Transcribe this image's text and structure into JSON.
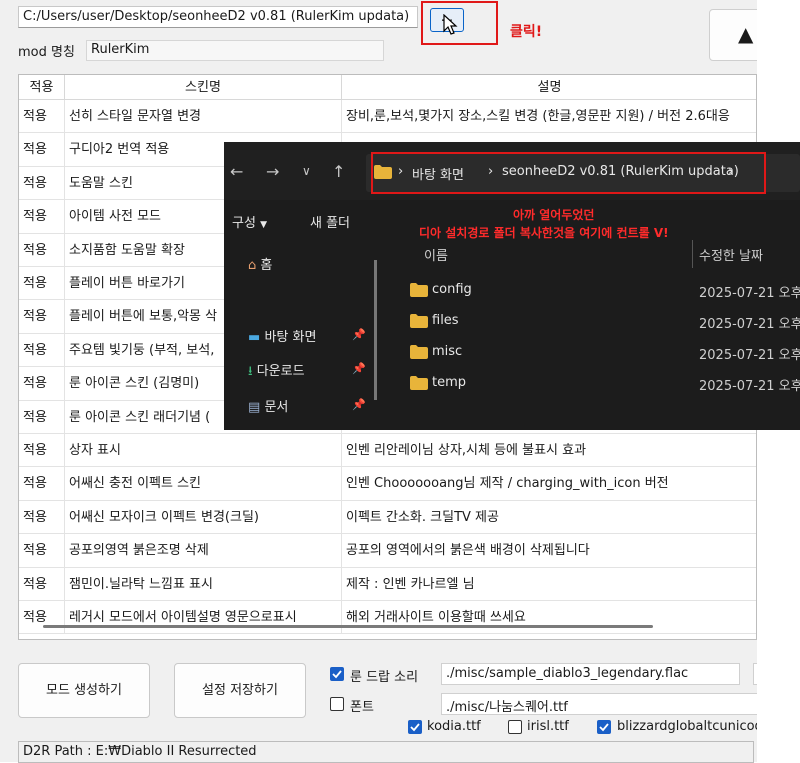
{
  "app": {
    "path_value": "C:/Users/user/Desktop/seonheeD2 v0.81 (RulerKim updata)",
    "browse_label": "...",
    "click_note": "클릭!",
    "up_label": "▲",
    "mod_name_label": "mod 명칭",
    "mod_name_value": "RulerKim",
    "columns": [
      "적용",
      "스킨명",
      "설명"
    ],
    "rows": [
      {
        "apply": "적용",
        "name": "선히 스타일 문자열 변경",
        "desc": "장비,룬,보석,몇가지 장소,스킬 변경 (한글,영문판 지원) / 버전 2.6대응"
      },
      {
        "apply": "적용",
        "name": "구디아2 번역 적용",
        "desc": ""
      },
      {
        "apply": "적용",
        "name": "도움말 스킨",
        "desc": ""
      },
      {
        "apply": "적용",
        "name": "아이템 사전 모드",
        "desc": ""
      },
      {
        "apply": "적용",
        "name": "소지품함 도움말 확장",
        "desc": ""
      },
      {
        "apply": "적용",
        "name": "플레이 버튼 바로가기",
        "desc": ""
      },
      {
        "apply": "적용",
        "name": "플레이 버튼에 보통,악몽 삭",
        "desc": ""
      },
      {
        "apply": "적용",
        "name": "주요템 빛기둥 (부적, 보석,",
        "desc": ""
      },
      {
        "apply": "적용",
        "name": "룬 아이콘 스킨 (김명미)",
        "desc": ""
      },
      {
        "apply": "적용",
        "name": "룬 아이콘 스킨 래더기념 (",
        "desc": ""
      },
      {
        "apply": "적용",
        "name": "상자 표시",
        "desc": "인벤 리안레이님 상자,시체 등에 불표시 효과"
      },
      {
        "apply": "적용",
        "name": "어쌔신 충전 이펙트 스킨",
        "desc": "인벤 Chooooooang님 제작 / charging_with_icon 버전"
      },
      {
        "apply": "적용",
        "name": "어쌔신 모자이크 이펙트 변경(크딜)",
        "desc": "이펙트 간소화. 크딜TV 제공"
      },
      {
        "apply": "적용",
        "name": "공포의영역 붉은조명 삭제",
        "desc": "공포의 영역에서의 붉은색 배경이 삭제됩니다"
      },
      {
        "apply": "적용",
        "name": "잼민이.닐라탁 느낌표 표시",
        "desc": "제작 : 인벤 카나르엘 님"
      },
      {
        "apply": "적용",
        "name": "레거시 모드에서 아이템설명 영문으로표시",
        "desc": "해외 거래사이트 이용할때 쓰세요"
      }
    ],
    "create_mod_button": "모드 생성하기",
    "save_settings_button": "설정 저장하기",
    "rune_drop_sound_label": "룬 드랍 소리",
    "rune_drop_sound_path": "./misc/sample_diablo3_legendary.flac",
    "font_label": "폰트",
    "font_path": "./misc/나눔스퀘어.ttf",
    "font_options": [
      {
        "label": "kodia.ttf",
        "checked": true
      },
      {
        "label": "irisl.ttf",
        "checked": false
      },
      {
        "label": "blizzardglobaltcunicode",
        "checked": true
      }
    ],
    "status_text": "D2R Path : E:₩Diablo II Resurrected"
  },
  "explorer": {
    "breadcrumbs": [
      "바탕 화면",
      "seonheeD2 v0.81 (RulerKim updata)"
    ],
    "toolbar_organize": "구성",
    "toolbar_new_folder": "새 폴더",
    "note_line1": "아까 열어두었던",
    "note_line2": "디아 설치경로 폴더 복사한것을 여기에 컨트롤 V!",
    "nav": [
      {
        "label": "홈"
      },
      {
        "label": "바탕 화면"
      },
      {
        "label": "다운로드"
      },
      {
        "label": "문서"
      }
    ],
    "col_name": "이름",
    "col_modified": "수정한 날짜",
    "files": [
      {
        "name": "config",
        "date": "2025-07-21 오후"
      },
      {
        "name": "files",
        "date": "2025-07-21 오후"
      },
      {
        "name": "misc",
        "date": "2025-07-21 오후"
      },
      {
        "name": "temp",
        "date": "2025-07-21 오후"
      }
    ]
  },
  "colors": {
    "accent": "#1a5fc7",
    "annotation_red": "#e01818",
    "folder": "#e8b43a"
  }
}
